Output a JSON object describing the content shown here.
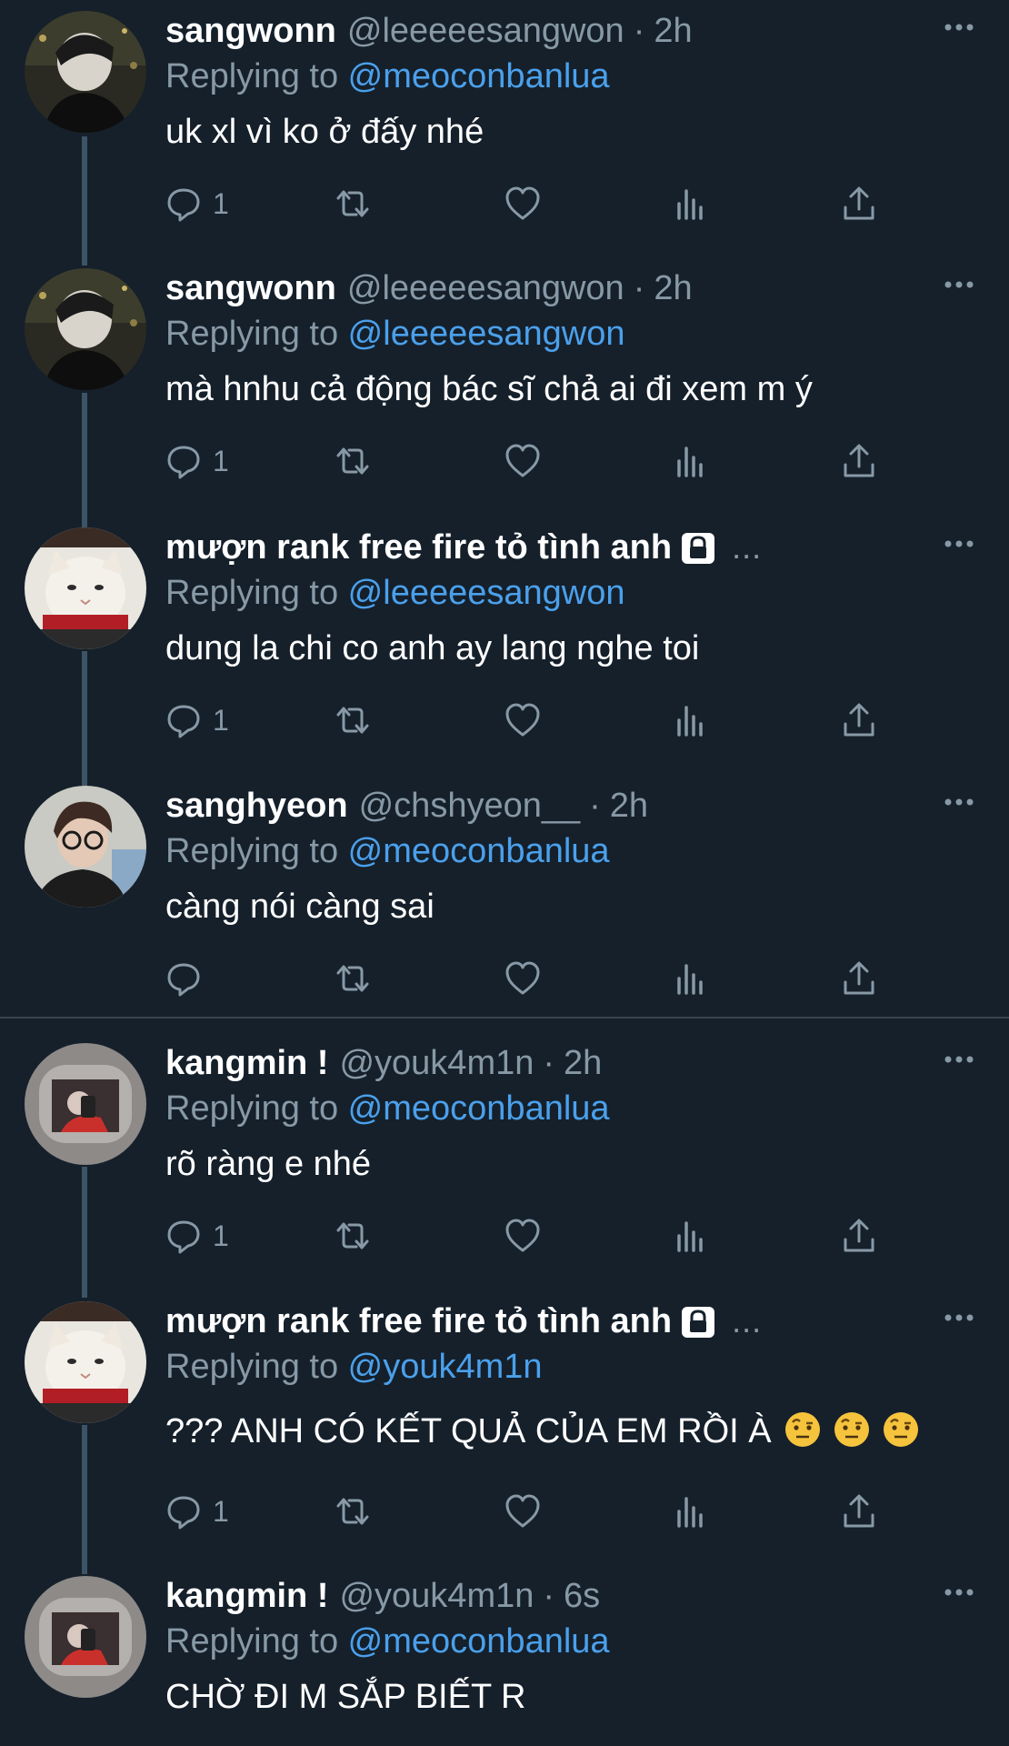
{
  "reply_prefix": "Replying to ",
  "tweets": [
    {
      "name": "sangwonn",
      "handle": "@leeeeesangwon",
      "time": "2h",
      "reply_to": "@meoconbanlua",
      "text": "uk xl vì ko ở đấy nhé",
      "reply_count": "1",
      "avatar": "guy-night",
      "locked": false
    },
    {
      "name": "sangwonn",
      "handle": "@leeeeesangwon",
      "time": "2h",
      "reply_to": "@leeeeesangwon",
      "text": "mà hnhu cả động bác sĩ chả ai đi xem m ý",
      "reply_count": "1",
      "avatar": "guy-night",
      "locked": false
    },
    {
      "name": "mượn rank free fire tỏ tình anh",
      "handle": "",
      "time": "",
      "ellipsis": "...",
      "reply_to": "@leeeeesangwon",
      "text": "dung la chi co anh ay lang nghe toi",
      "reply_count": "1",
      "avatar": "cat-meme",
      "locked": true
    },
    {
      "name": "sanghyeon",
      "handle": "@chshyeon__",
      "time": "2h",
      "reply_to": "@meoconbanlua",
      "text": "càng nói càng sai",
      "reply_count": "",
      "avatar": "guy-glasses",
      "locked": false
    },
    {
      "name": "kangmin !",
      "handle": "@youk4m1n",
      "time": "2h",
      "reply_to": "@meoconbanlua",
      "text": "rõ ràng e nhé",
      "reply_count": "1",
      "avatar": "mirror-selfie",
      "locked": false
    },
    {
      "name": "mượn rank free fire tỏ tình anh",
      "handle": "",
      "time": "",
      "ellipsis": "...",
      "reply_to": "@youk4m1n",
      "text": "??? ANH CÓ KẾT QUẢ CỦA EM RỒI À",
      "emojis": [
        "face-with-raised-eyebrow",
        "face-with-raised-eyebrow",
        "face-with-raised-eyebrow"
      ],
      "reply_count": "1",
      "avatar": "cat-meme",
      "locked": true
    },
    {
      "name": "kangmin !",
      "handle": "@youk4m1n",
      "time": "6s",
      "reply_to": "@meoconbanlua",
      "text": "CHỜ ĐI M SẮP BIẾT R",
      "reply_count": "",
      "avatar": "mirror-selfie",
      "locked": false
    }
  ],
  "colors": {
    "background": "#15202b",
    "secondary_text": "#8899a6",
    "link": "#4ba0eb",
    "thread_line": "#3d5466"
  },
  "icons": [
    "reply-icon",
    "retweet-icon",
    "like-icon",
    "analytics-icon",
    "share-icon",
    "more-options-icon",
    "lock-icon"
  ]
}
